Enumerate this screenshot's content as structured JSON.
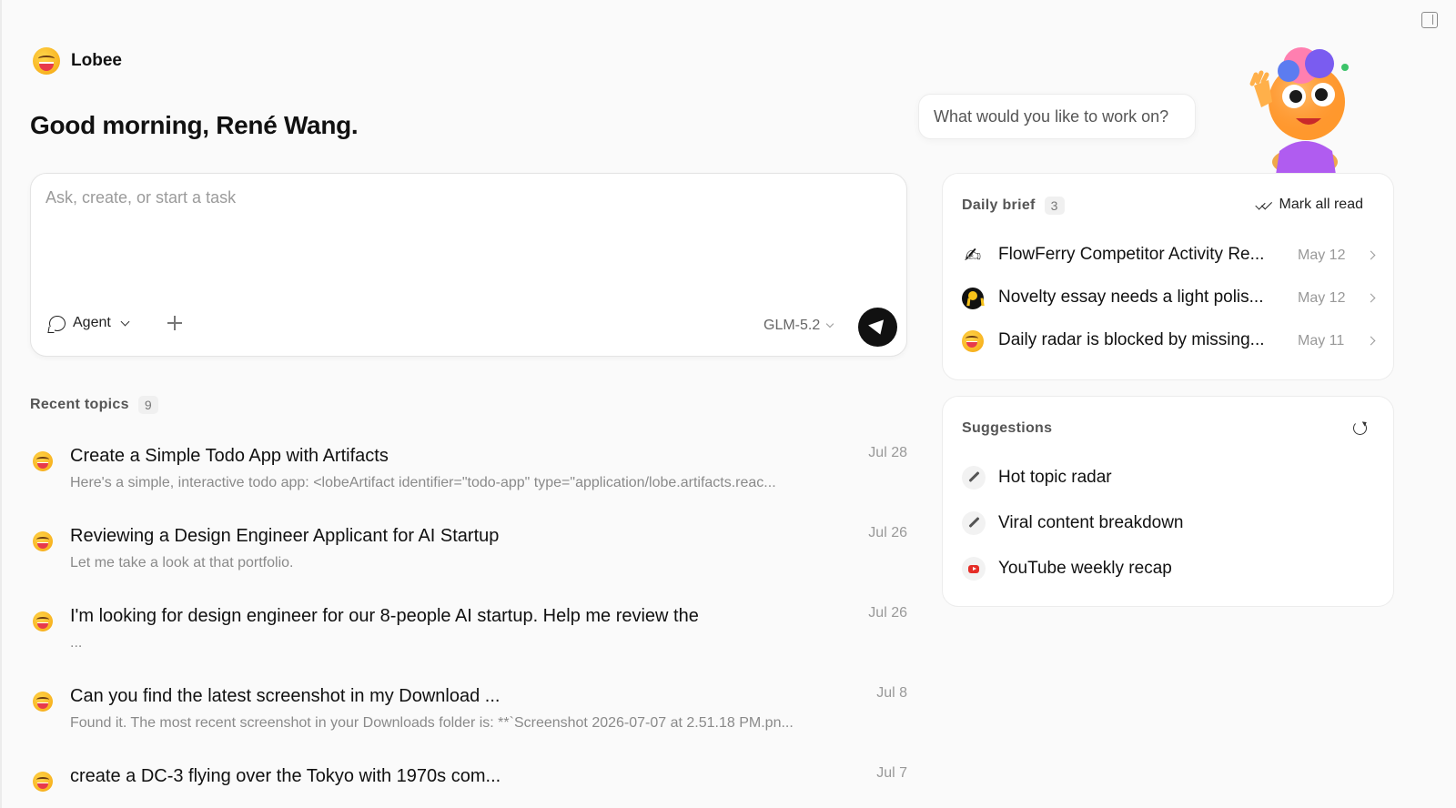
{
  "brand": {
    "name": "Lobee"
  },
  "greeting": "Good morning, René Wang.",
  "composer": {
    "placeholder": "Ask, create, or start a task",
    "mode_label": "Agent",
    "model_label": "GLM-5.2"
  },
  "recent": {
    "title": "Recent topics",
    "count": "9",
    "items": [
      {
        "title": "Create a Simple Todo App with Artifacts",
        "preview": "Here's a simple, interactive todo app: <lobeArtifact identifier=\"todo-app\" type=\"application/lobe.artifacts.reac...",
        "date": "Jul 28"
      },
      {
        "title": "Reviewing a Design Engineer Applicant for AI Startup",
        "preview": "Let me take a look at that portfolio.",
        "date": "Jul 26"
      },
      {
        "title": "I'm looking for design engineer for our 8-people AI startup. Help me review the",
        "preview": "...",
        "date": "Jul 26"
      },
      {
        "title": "Can you find the latest screenshot in my Download ...",
        "preview": "Found it. The most recent screenshot in your Downloads folder is: **`Screenshot 2026-07-07 at 2.51.18 PM.pn...",
        "date": "Jul 8"
      },
      {
        "title": "create a DC-3 flying over the Tokyo with 1970s com...",
        "preview": "",
        "date": "Jul 7"
      }
    ]
  },
  "prompt_bubble": "What would you like to work on?",
  "brief": {
    "title": "Daily brief",
    "count": "3",
    "mark_all_read": "Mark all read",
    "items": [
      {
        "icon": "waving-hand-icon",
        "title": "FlowFerry Competitor Activity Re...",
        "date": "May 12"
      },
      {
        "icon": "ribbon-icon",
        "title": "Novelty essay needs a light polis...",
        "date": "May 12"
      },
      {
        "icon": "grinning-face-icon",
        "title": "Daily radar is blocked by missing...",
        "date": "May 11"
      }
    ]
  },
  "suggestions": {
    "title": "Suggestions",
    "items": [
      {
        "icon": "pencil-icon",
        "label": "Hot topic radar"
      },
      {
        "icon": "pencil-icon",
        "label": "Viral content breakdown"
      },
      {
        "icon": "youtube-icon",
        "label": "YouTube weekly recap"
      }
    ]
  },
  "colors": {
    "background": "#fafafa",
    "card": "#ffffff",
    "accent": "#111111",
    "muted": "#999999"
  }
}
